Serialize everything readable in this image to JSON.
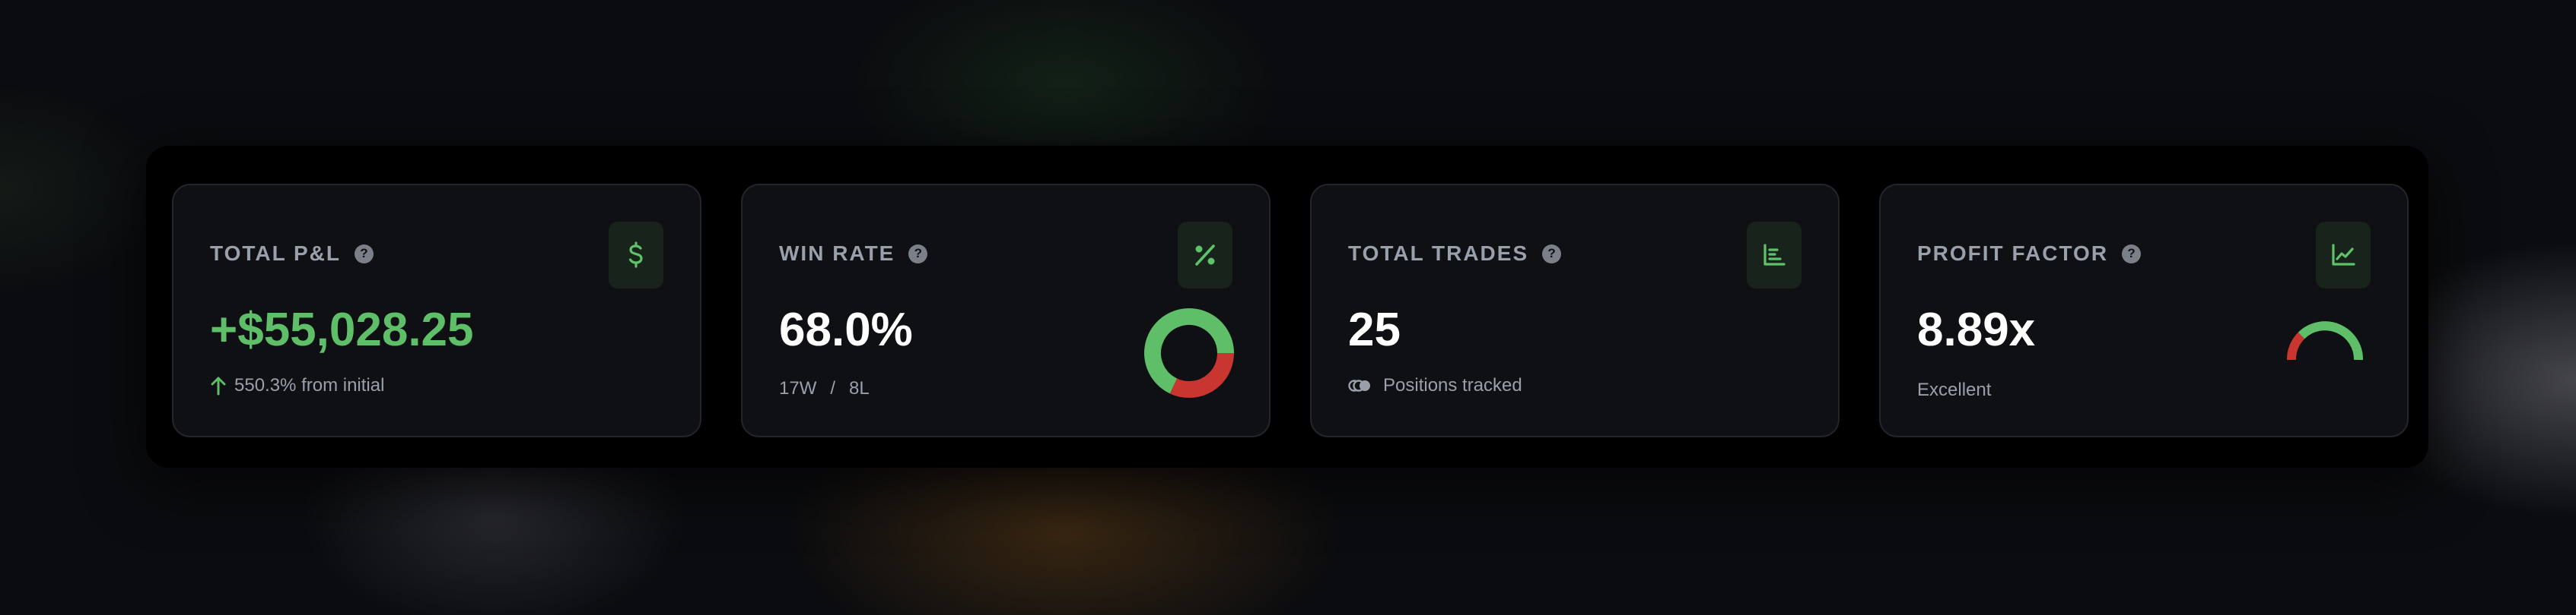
{
  "cards": [
    {
      "title": "TOTAL P&L",
      "value": "+$55,028.25",
      "sub": "550.3% from initial",
      "icon": "dollar-icon"
    },
    {
      "title": "WIN RATE",
      "value": "68.0%",
      "wins": "17W",
      "separator": "/",
      "losses": "8L",
      "icon": "percent-icon",
      "donut": {
        "win_fraction": 0.68
      }
    },
    {
      "title": "TOTAL TRADES",
      "value": "25",
      "sub": "Positions tracked",
      "icon": "bar-chart-icon"
    },
    {
      "title": "PROFIT FACTOR",
      "value": "8.89x",
      "sub": "Excellent",
      "icon": "line-chart-icon"
    }
  ],
  "colors": {
    "green": "#5fbf69",
    "red": "#c9352f",
    "card_bg": "#0f1014",
    "border": "#23252b"
  }
}
